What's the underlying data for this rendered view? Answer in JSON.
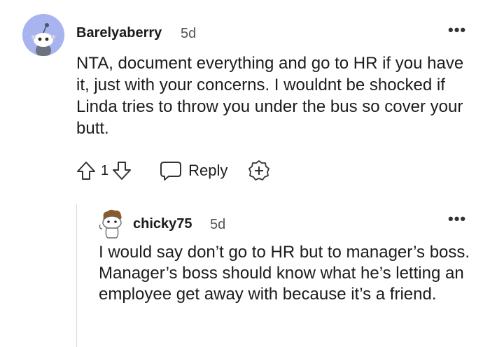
{
  "top_comment": {
    "username": "Barelyaberry",
    "age": "5d",
    "more": "•••",
    "body": "NTA, document everything and go to HR if you have it, just with your concerns. I wouldnt be shocked if Linda tries to throw you under the bus so cover your butt.",
    "vote_count": "1",
    "reply_label": "Reply",
    "avatar_color": "#a8b4f0"
  },
  "reply_comment": {
    "username": "chicky75",
    "age": "5d",
    "more": "•••",
    "body": "I would say don’t go to HR but to manager’s boss. Manager’s boss should know what he’s letting an employee get away with because it’s a friend."
  }
}
